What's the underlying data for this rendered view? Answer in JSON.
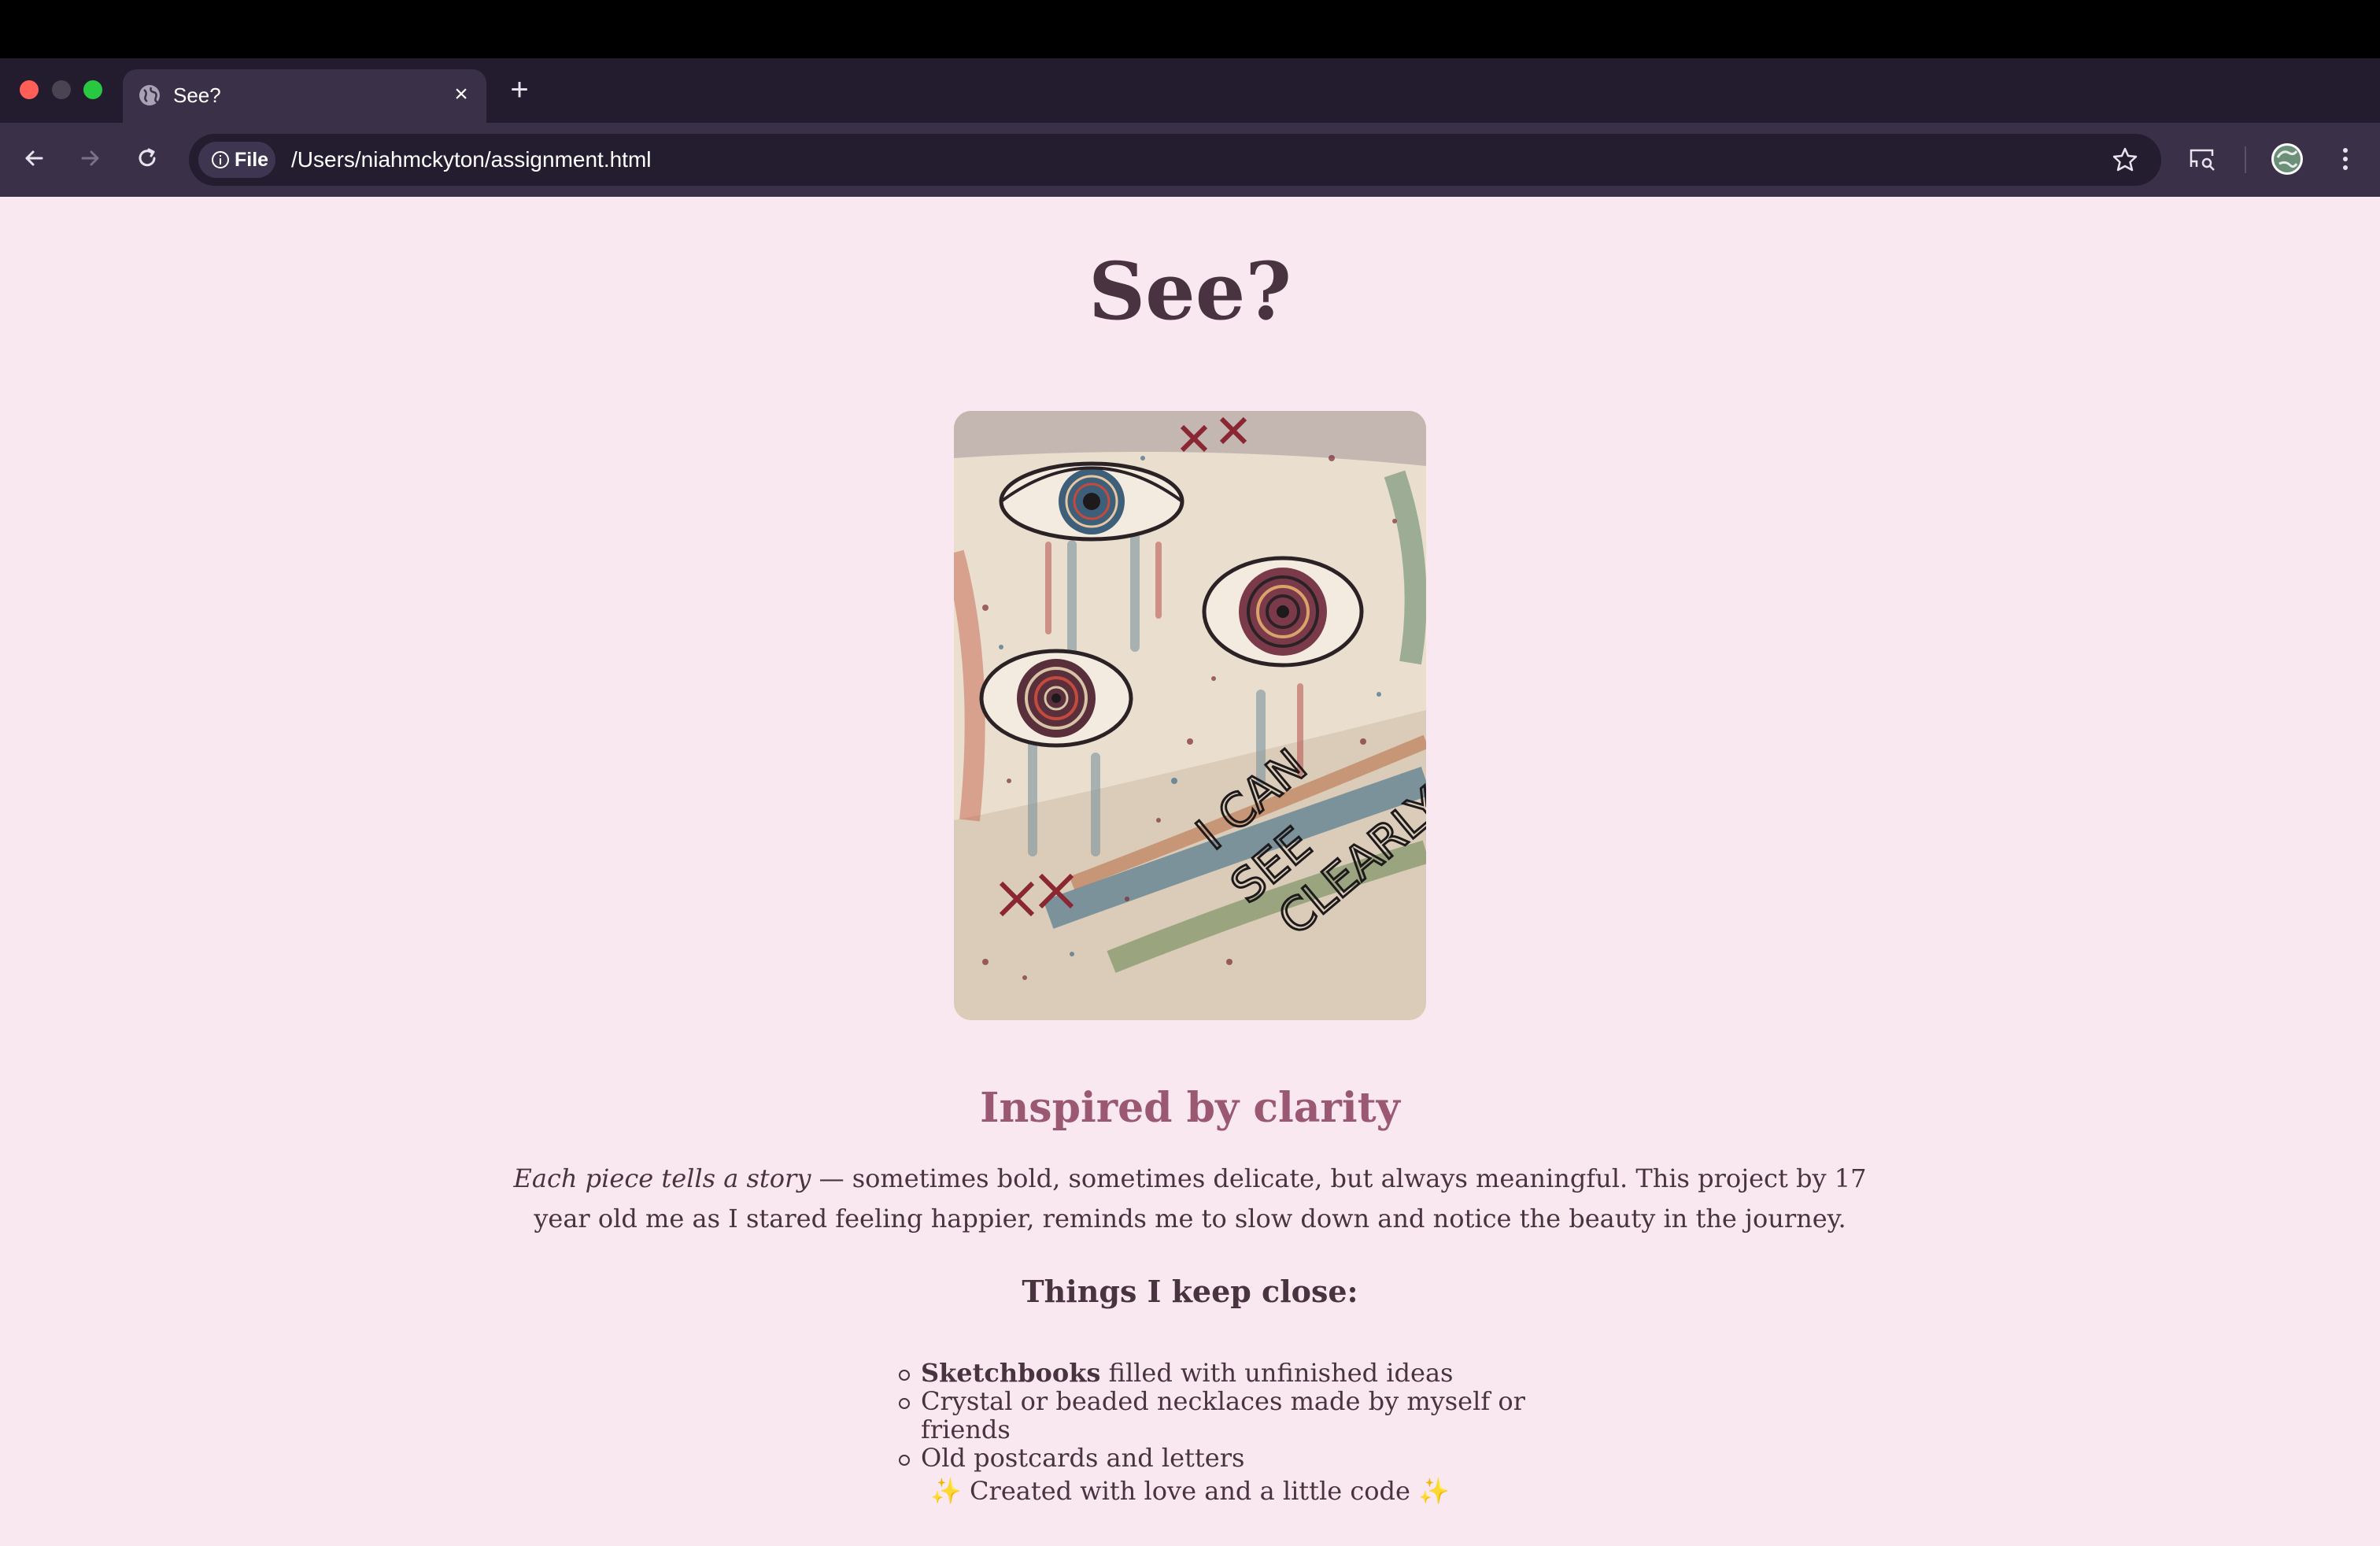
{
  "browser": {
    "tab_title": "See?",
    "tab_close": "×",
    "new_tab": "+",
    "site_chip": "File",
    "url": "/Users/niahmckyton/assignment.html"
  },
  "page": {
    "title": "See?",
    "artwork_icon": "painting-eyes-i-can-see-clearly",
    "artwork_text": [
      "I CAN",
      "SEE",
      "CLEARLY"
    ],
    "subtitle": "Inspired by clarity",
    "intro_italic": "Each piece tells a story",
    "intro_rest": " — sometimes bold, sometimes delicate, but always meaningful. This project by 17 year old me as I stared feeling happier, reminds me to slow down and notice the beauty in the journey.",
    "list_heading": "Things I keep close:",
    "list": [
      {
        "bold": "Sketchbooks",
        "text": " filled with unfinished ideas"
      },
      {
        "bold": "",
        "text": "Crystal or beaded necklaces made by myself or friends"
      },
      {
        "bold": "",
        "text": "Old postcards and letters"
      }
    ],
    "footer_left_sparkle": "✨",
    "footer_text": " Created with love and a little code ",
    "footer_right_sparkle": "✨"
  },
  "colors": {
    "page_background": "#f9e8ef",
    "heading": "#4a3340",
    "subtitle": "#9a5873",
    "toolbar": "#3a3148",
    "tabbar": "#231c2f"
  }
}
